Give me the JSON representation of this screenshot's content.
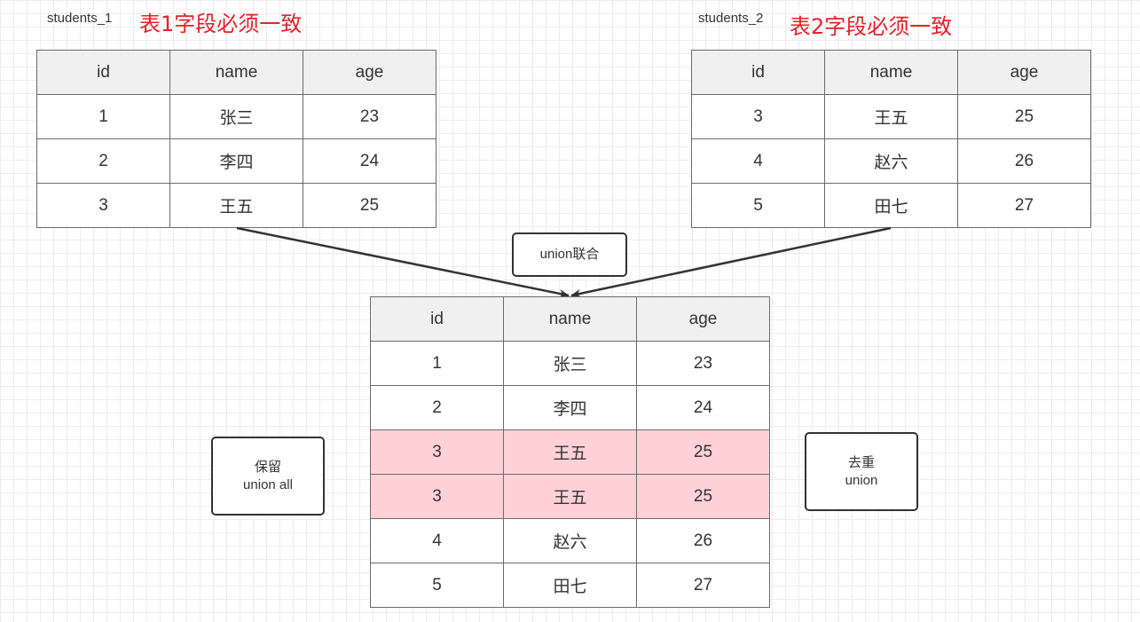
{
  "table1": {
    "name": "students_1",
    "note": "表1字段必须一致",
    "columns": [
      "id",
      "name",
      "age"
    ],
    "rows": [
      [
        "1",
        "张三",
        "23"
      ],
      [
        "2",
        "李四",
        "24"
      ],
      [
        "3",
        "王五",
        "25"
      ]
    ]
  },
  "table2": {
    "name": "students_2",
    "note": "表2字段必须一致",
    "columns": [
      "id",
      "name",
      "age"
    ],
    "rows": [
      [
        "3",
        "王五",
        "25"
      ],
      [
        "4",
        "赵六",
        "26"
      ],
      [
        "5",
        "田七",
        "27"
      ]
    ]
  },
  "union_label": "union联合",
  "result": {
    "columns": [
      "id",
      "name",
      "age"
    ],
    "rows": [
      [
        "1",
        "张三",
        "23"
      ],
      [
        "2",
        "李四",
        "24"
      ],
      [
        "3",
        "王五",
        "25"
      ],
      [
        "3",
        "王五",
        "25"
      ],
      [
        "4",
        "赵六",
        "26"
      ],
      [
        "5",
        "田七",
        "27"
      ]
    ],
    "highlight_rows": [
      2,
      3
    ],
    "highlight_color": "#ffd1d6"
  },
  "left_note": {
    "line1": "保留",
    "line2": "union all"
  },
  "right_note": {
    "line1": "去重",
    "line2": "union"
  },
  "colors": {
    "note_red": "#e8202a",
    "header_gray": "#f0f0f0",
    "border": "#6b6b6b"
  }
}
